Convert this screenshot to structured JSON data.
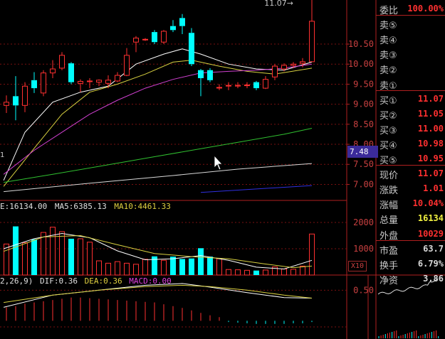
{
  "chart_data": [
    {
      "type": "candlestick",
      "title": "",
      "ylim": [
        6.6,
        11.6
      ],
      "y_ticks": [
        "10.50",
        "10.00",
        "9.50",
        "9.00",
        "8.50",
        "8.00",
        "7.50",
        "7.00"
      ],
      "y_tick_values": [
        10.5,
        10.0,
        9.5,
        9.0,
        8.5,
        8.0,
        7.5,
        7.0
      ],
      "top_label": "11.07",
      "candles": [
        {
          "o": 8.97,
          "c": 9.05,
          "h": 9.22,
          "l": 8.78
        },
        {
          "o": 9.2,
          "c": 8.97,
          "h": 9.7,
          "l": 8.6
        },
        {
          "o": 8.97,
          "c": 9.45,
          "h": 9.55,
          "l": 8.8
        },
        {
          "o": 9.6,
          "c": 9.4,
          "h": 9.8,
          "l": 9.28
        },
        {
          "o": 9.28,
          "c": 9.78,
          "h": 9.85,
          "l": 9.2
        },
        {
          "o": 9.78,
          "c": 9.88,
          "h": 10.1,
          "l": 9.65
        },
        {
          "o": 9.9,
          "c": 10.22,
          "h": 10.3,
          "l": 9.85
        },
        {
          "o": 10.02,
          "c": 9.55,
          "h": 10.05,
          "l": 9.5
        },
        {
          "o": 9.52,
          "c": 9.57,
          "h": 9.62,
          "l": 9.3
        },
        {
          "o": 9.58,
          "c": 9.58,
          "h": 9.65,
          "l": 9.4
        },
        {
          "o": 9.55,
          "c": 9.6,
          "h": 9.62,
          "l": 9.45
        },
        {
          "o": 9.52,
          "c": 9.6,
          "h": 9.72,
          "l": 9.4
        },
        {
          "o": 9.58,
          "c": 9.72,
          "h": 9.8,
          "l": 9.55
        },
        {
          "o": 9.72,
          "c": 10.22,
          "h": 10.4,
          "l": 9.7
        },
        {
          "o": 10.55,
          "c": 10.65,
          "h": 10.7,
          "l": 10.3
        },
        {
          "o": 10.62,
          "c": 10.62,
          "h": 10.65,
          "l": 10.58
        },
        {
          "o": 10.8,
          "c": 10.55,
          "h": 10.85,
          "l": 10.5
        },
        {
          "o": 10.55,
          "c": 10.82,
          "h": 10.85,
          "l": 10.5
        },
        {
          "o": 10.95,
          "c": 10.85,
          "h": 11.1,
          "l": 10.8
        },
        {
          "o": 11.15,
          "c": 10.95,
          "h": 11.25,
          "l": 10.75
        },
        {
          "o": 10.78,
          "c": 10.0,
          "h": 10.9,
          "l": 9.95
        },
        {
          "o": 9.85,
          "c": 9.65,
          "h": 9.88,
          "l": 9.2
        },
        {
          "o": 9.85,
          "c": 9.6,
          "h": 9.9,
          "l": 9.55
        },
        {
          "o": 9.42,
          "c": 9.42,
          "h": 9.5,
          "l": 9.35
        },
        {
          "o": 9.47,
          "c": 9.47,
          "h": 9.55,
          "l": 9.35
        },
        {
          "o": 9.47,
          "c": 9.47,
          "h": 9.55,
          "l": 9.4
        },
        {
          "o": 9.48,
          "c": 9.48,
          "h": 9.55,
          "l": 9.4
        },
        {
          "o": 9.55,
          "c": 9.4,
          "h": 9.58,
          "l": 9.35
        },
        {
          "o": 9.4,
          "c": 9.62,
          "h": 9.7,
          "l": 9.38
        },
        {
          "o": 9.68,
          "c": 9.95,
          "h": 10.0,
          "l": 9.6
        },
        {
          "o": 9.88,
          "c": 9.97,
          "h": 10.02,
          "l": 9.82
        },
        {
          "o": 9.97,
          "c": 10.0,
          "h": 10.05,
          "l": 9.9
        },
        {
          "o": 10.02,
          "c": 10.06,
          "h": 10.15,
          "l": 9.92
        },
        {
          "o": 10.06,
          "c": 11.07,
          "h": 11.6,
          "l": 10.05
        }
      ],
      "ma_lines": [
        {
          "name": "MA5",
          "color": "#ffffff",
          "points": [
            [
              -0.3,
              7.1
            ],
            [
              2,
              8.3
            ],
            [
              5,
              9.05
            ],
            [
              8,
              9.3
            ],
            [
              11,
              9.45
            ],
            [
              14,
              10.0
            ],
            [
              17,
              10.25
            ],
            [
              19,
              10.38
            ],
            [
              21,
              10.25
            ],
            [
              24,
              10.0
            ],
            [
              27,
              9.88
            ],
            [
              30,
              9.85
            ],
            [
              33,
              10.05
            ]
          ]
        },
        {
          "name": "MA10",
          "color": "#d8d040",
          "points": [
            [
              -0.3,
              6.95
            ],
            [
              3,
              7.9
            ],
            [
              6,
              8.75
            ],
            [
              9,
              9.3
            ],
            [
              12,
              9.5
            ],
            [
              15,
              9.75
            ],
            [
              18,
              10.05
            ],
            [
              20,
              10.1
            ],
            [
              23,
              9.95
            ],
            [
              26,
              9.82
            ],
            [
              29,
              9.75
            ],
            [
              33,
              9.9
            ]
          ]
        },
        {
          "name": "MA20",
          "color": "#d040d0",
          "points": [
            [
              -0.3,
              7.25
            ],
            [
              3,
              7.85
            ],
            [
              6,
              8.3
            ],
            [
              9,
              8.75
            ],
            [
              12,
              9.1
            ],
            [
              15,
              9.4
            ],
            [
              18,
              9.62
            ],
            [
              21,
              9.78
            ],
            [
              24,
              9.82
            ],
            [
              27,
              9.85
            ],
            [
              30,
              9.9
            ],
            [
              33,
              10.0
            ]
          ]
        },
        {
          "name": "MA60",
          "color": "#30c030",
          "points": [
            [
              -0.3,
              7.05
            ],
            [
              5,
              7.25
            ],
            [
              10,
              7.45
            ],
            [
              15,
              7.65
            ],
            [
              20,
              7.85
            ],
            [
              25,
              8.05
            ],
            [
              30,
              8.25
            ],
            [
              33,
              8.4
            ]
          ]
        },
        {
          "name": "MA120",
          "color": "#d8d8d8",
          "points": [
            [
              -0.3,
              6.82
            ],
            [
              10,
              7.05
            ],
            [
              18,
              7.22
            ],
            [
              25,
              7.38
            ],
            [
              33,
              7.52
            ]
          ]
        },
        {
          "name": "MA250",
          "color": "#3030e0",
          "points": [
            [
              21,
              6.8
            ],
            [
              33,
              6.97
            ]
          ]
        }
      ],
      "price_tag": "7.48",
      "left_edge_label": "1"
    },
    {
      "type": "bar",
      "ylim": [
        0,
        2000
      ],
      "y_ticks": [
        "2000",
        "1000"
      ],
      "y_tick_values": [
        2000,
        1000
      ],
      "legend": {
        "vol": "E:16134.00",
        "ma5": "MA5:6385.13",
        "ma10": "MA10:4461.33"
      },
      "volumes": [
        1180,
        1850,
        1230,
        1360,
        1620,
        1820,
        1650,
        1380,
        1380,
        1250,
        540,
        450,
        510,
        450,
        410,
        600,
        710,
        560,
        700,
        610,
        630,
        1020,
        700,
        620,
        210,
        200,
        180,
        170,
        190,
        310,
        230,
        220,
        340,
        1560
      ],
      "vol_ma5": {
        "color": "#ffffff",
        "points": [
          [
            -0.3,
            1000
          ],
          [
            3,
            1380
          ],
          [
            6,
            1580
          ],
          [
            9,
            1420
          ],
          [
            12,
            920
          ],
          [
            15,
            580
          ],
          [
            18,
            620
          ],
          [
            21,
            740
          ],
          [
            24,
            560
          ],
          [
            27,
            300
          ],
          [
            30,
            230
          ],
          [
            33,
            560
          ]
        ]
      },
      "vol_ma10": {
        "color": "#d8d040",
        "points": [
          [
            -0.3,
            900
          ],
          [
            4,
            1450
          ],
          [
            8,
            1500
          ],
          [
            12,
            1150
          ],
          [
            16,
            820
          ],
          [
            20,
            700
          ],
          [
            24,
            620
          ],
          [
            28,
            420
          ],
          [
            31,
            280
          ],
          [
            33,
            340
          ]
        ]
      },
      "scale_label": "X10"
    },
    {
      "type": "line",
      "ylim": [
        -0.1,
        0.62
      ],
      "y_ticks": [
        "0.50"
      ],
      "y_tick_values": [
        0.5
      ],
      "legend": {
        "params": "2,26,9)",
        "dif": "DIF:0.36",
        "dea": "DEA:0.36",
        "macd": "MACD:0.00"
      },
      "dif": {
        "color": "#ffffff",
        "points": [
          [
            -0.3,
            0.22
          ],
          [
            5,
            0.42
          ],
          [
            10,
            0.5
          ],
          [
            15,
            0.58
          ],
          [
            19,
            0.61
          ],
          [
            22,
            0.55
          ],
          [
            26,
            0.46
          ],
          [
            30,
            0.38
          ],
          [
            33,
            0.37
          ]
        ]
      },
      "dea": {
        "color": "#d8d040",
        "points": [
          [
            -0.3,
            0.3
          ],
          [
            5,
            0.42
          ],
          [
            10,
            0.5
          ],
          [
            15,
            0.56
          ],
          [
            19,
            0.58
          ],
          [
            22,
            0.56
          ],
          [
            26,
            0.5
          ],
          [
            30,
            0.42
          ],
          [
            33,
            0.37
          ]
        ]
      },
      "macd_bars": [
        0.22,
        0.24,
        0.28,
        0.3,
        0.32,
        0.34,
        0.36,
        0.38,
        0.38,
        0.37,
        0.36,
        0.35,
        0.34,
        0.33,
        0.32,
        0.31,
        0.3,
        0.27,
        0.24,
        0.21,
        0.17,
        0.13,
        0.09,
        0.06,
        -0.02,
        -0.03,
        -0.04,
        -0.05,
        -0.05,
        -0.05,
        -0.05,
        -0.04,
        -0.04,
        -0.02
      ]
    }
  ],
  "quotes": [
    {
      "label": "委比",
      "value": "100.00%",
      "color": "#ff3030"
    },
    {
      "label": "卖⑤",
      "value": "",
      "color": "#ff3030"
    },
    {
      "label": "卖④",
      "value": "",
      "color": "#ff3030"
    },
    {
      "label": "卖③",
      "value": "",
      "color": "#ff3030"
    },
    {
      "label": "卖②",
      "value": "",
      "color": "#ff3030"
    },
    {
      "label": "卖①",
      "value": "",
      "color": "#ff3030"
    },
    {
      "label": "买①",
      "value": "11.07",
      "color": "#ff3030"
    },
    {
      "label": "买②",
      "value": "11.05",
      "color": "#ff3030"
    },
    {
      "label": "买③",
      "value": "11.00",
      "color": "#ff3030"
    },
    {
      "label": "买④",
      "value": "10.98",
      "color": "#ff3030"
    },
    {
      "label": "买⑤",
      "value": "10.95",
      "color": "#ff3030"
    },
    {
      "label": "现价",
      "value": "11.07",
      "color": "#ff3030"
    },
    {
      "label": "涨跌",
      "value": "1.01",
      "color": "#ff3030"
    },
    {
      "label": "涨幅",
      "value": "10.04%",
      "color": "#ff3030"
    },
    {
      "label": "总量",
      "value": "16134",
      "color": "#f0f040"
    },
    {
      "label": "外盘",
      "value": "10029",
      "color": "#ff3030"
    },
    {
      "label": "市盈",
      "value": "63.7",
      "color": "#d8d8d8"
    },
    {
      "label": "换手",
      "value": "6.79%",
      "color": "#d8d8d8"
    },
    {
      "label": "净资",
      "value": "3.86",
      "color": "#d8d8d8"
    }
  ],
  "colors": {
    "up": "#ff3030",
    "down": "#00ffff",
    "grid": "#7a1010",
    "axis": "#b02020",
    "text_axis": "#c84040",
    "bg": "#000000"
  }
}
